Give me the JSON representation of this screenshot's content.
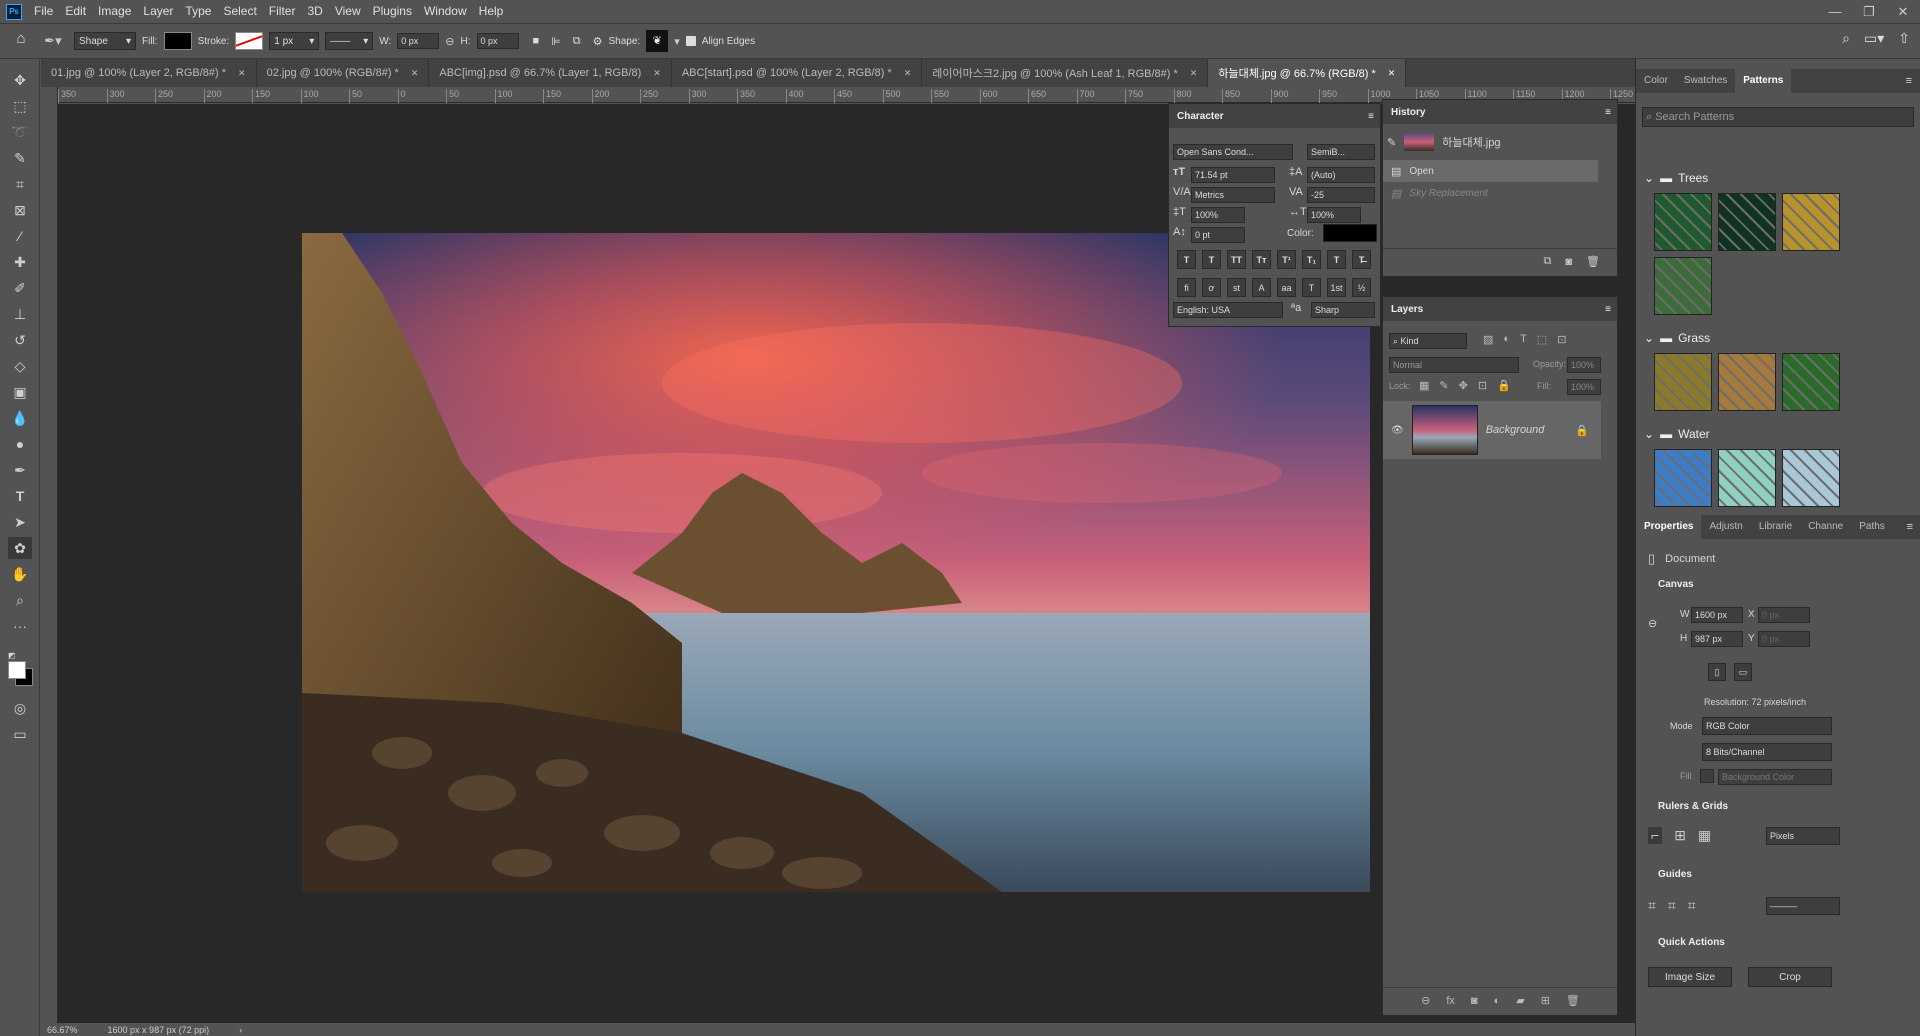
{
  "app": {
    "logo": "Ps"
  },
  "menu": [
    "File",
    "Edit",
    "Image",
    "Layer",
    "Type",
    "Select",
    "Filter",
    "3D",
    "View",
    "Plugins",
    "Window",
    "Help"
  ],
  "window_controls": {
    "minimize": "—",
    "restore": "❐",
    "close": "✕"
  },
  "options_bar": {
    "mode": "Shape",
    "fill_label": "Fill:",
    "stroke_label": "Stroke:",
    "stroke_width": "1 px",
    "w_label": "W:",
    "w_value": "0 px",
    "h_label": "H:",
    "h_value": "0 px",
    "shape_label": "Shape:",
    "align_edges": "Align Edges",
    "fill_color": "#000000"
  },
  "doc_tabs": [
    {
      "label": "01.jpg @ 100% (Layer 2, RGB/8#) *",
      "active": false
    },
    {
      "label": "02.jpg @ 100% (RGB/8#) *",
      "active": false
    },
    {
      "label": "ABC[img].psd @ 66.7% (Layer 1, RGB/8)",
      "active": false
    },
    {
      "label": "ABC[start].psd @ 100% (Layer 2, RGB/8) *",
      "active": false
    },
    {
      "label": "레이어마스크2.jpg @ 100% (Ash Leaf 1, RGB/8#) *",
      "active": false
    },
    {
      "label": "하늘대체.jpg @ 66.7% (RGB/8) *",
      "active": true
    }
  ],
  "ruler_ticks": [
    "350",
    "300",
    "250",
    "200",
    "150",
    "100",
    "50",
    "0",
    "50",
    "100",
    "150",
    "200",
    "250",
    "300",
    "350",
    "400",
    "450",
    "500",
    "550",
    "600",
    "650",
    "700",
    "750",
    "800",
    "850",
    "900",
    "950",
    "1000",
    "1050",
    "1100",
    "1150",
    "1200",
    "1250"
  ],
  "status": {
    "zoom": "66.67%",
    "doc_info": "1600 px x 987 px (72 ppi)"
  },
  "character": {
    "title": "Character",
    "font_family": "Open Sans Cond...",
    "font_style": "SemiB...",
    "size": "71.54 pt",
    "leading": "(Auto)",
    "kerning": "Metrics",
    "tracking": "-25",
    "vscale": "100%",
    "hscale": "100%",
    "baseline": "0 pt",
    "color_label": "Color:",
    "language": "English: USA",
    "antialias": "Sharp",
    "styles": [
      "T",
      "T",
      "TT",
      "Tт",
      "T¹",
      "T₁",
      "T",
      "T̶"
    ],
    "ot": [
      "fi",
      "ơ",
      "st",
      "A",
      "aa",
      "T",
      "1st",
      "½"
    ]
  },
  "history": {
    "title": "History",
    "snapshot": "하늘대체.jpg",
    "items": [
      {
        "label": "Open",
        "active": true
      },
      {
        "label": "Sky Replacement",
        "active": false
      }
    ]
  },
  "layers": {
    "title": "Layers",
    "kind": "Kind",
    "blend": "Normal",
    "opacity_label": "Opacity:",
    "opacity": "100%",
    "lock_label": "Lock:",
    "fill_label": "Fill:",
    "fill": "100%",
    "items": [
      {
        "name": "Background"
      }
    ]
  },
  "patterns": {
    "tabs": [
      {
        "label": "Color",
        "active": false
      },
      {
        "label": "Swatches",
        "active": false
      },
      {
        "label": "Patterns",
        "active": true
      }
    ],
    "search_placeholder": "Search Patterns",
    "groups": [
      {
        "name": "Trees",
        "colors": [
          "#1f5a2e",
          "#0f3320",
          "#b8922a",
          "#3d6b3a"
        ]
      },
      {
        "name": "Grass",
        "colors": [
          "#8a7a2a",
          "#a57a3c",
          "#2a6b2a"
        ]
      },
      {
        "name": "Water",
        "colors": [
          "#3d7dc8",
          "#8fd0c0",
          "#a8c8d8"
        ]
      }
    ]
  },
  "properties": {
    "tabs": [
      {
        "label": "Properties",
        "active": true
      },
      {
        "label": "Adjustn",
        "active": false
      },
      {
        "label": "Librarie",
        "active": false
      },
      {
        "label": "Channe",
        "active": false
      },
      {
        "label": "Paths",
        "active": false
      }
    ],
    "doc_label": "Document",
    "canvas_title": "Canvas",
    "w_label": "W",
    "w": "1600 px",
    "h_label": "H",
    "h": "987 px",
    "x_label": "X",
    "x_placeholder": "0 px",
    "y_label": "Y",
    "y_placeholder": "0 px",
    "resolution": "Resolution: 72 pixels/inch",
    "mode_label": "Mode",
    "mode": "RGB Color",
    "bits": "8 Bits/Channel",
    "fill_label": "Fill",
    "fill": "Background Color",
    "rulers_title": "Rulers & Grids",
    "units": "Pixels",
    "guides_title": "Guides",
    "quick_title": "Quick Actions",
    "image_size": "Image Size",
    "crop": "Crop"
  }
}
